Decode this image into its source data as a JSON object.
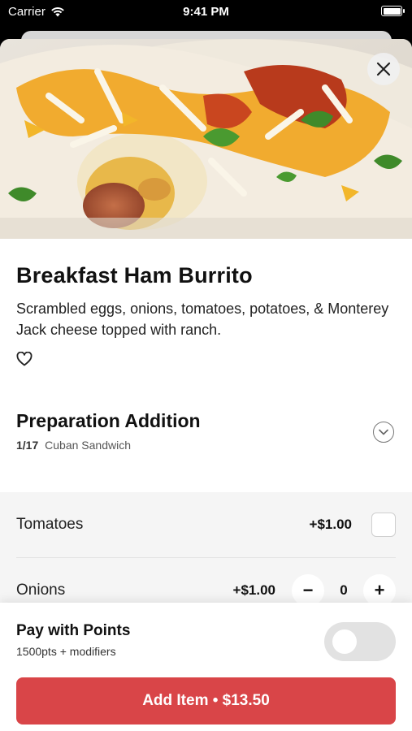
{
  "status_bar": {
    "carrier": "Carrier",
    "time": "9:41 PM"
  },
  "item": {
    "title": "Breakfast Ham Burrito",
    "description": "Scrambled eggs, onions, tomatoes, potatoes, & Monterey Jack cheese topped with ranch."
  },
  "preparation": {
    "title": "Preparation Addition",
    "count": "1/17",
    "selected": "Cuban Sandwich"
  },
  "options": [
    {
      "name": "Tomatoes",
      "price": "+$1.00",
      "control": "checkbox",
      "checked": false
    },
    {
      "name": "Onions",
      "price": "+$1.00",
      "control": "stepper",
      "quantity": "0",
      "minus": "−",
      "plus": "+"
    }
  ],
  "points": {
    "title": "Pay with Points",
    "subtitle": "1500pts + modifiers",
    "enabled": false
  },
  "add_button": {
    "label": "Add Item • $13.50"
  },
  "colors": {
    "accent": "#d94548",
    "toggle_off": "#e2e2e2"
  },
  "icons": [
    "wifi-icon",
    "battery-icon",
    "close-icon",
    "heart-icon",
    "chevron-down-icon"
  ]
}
